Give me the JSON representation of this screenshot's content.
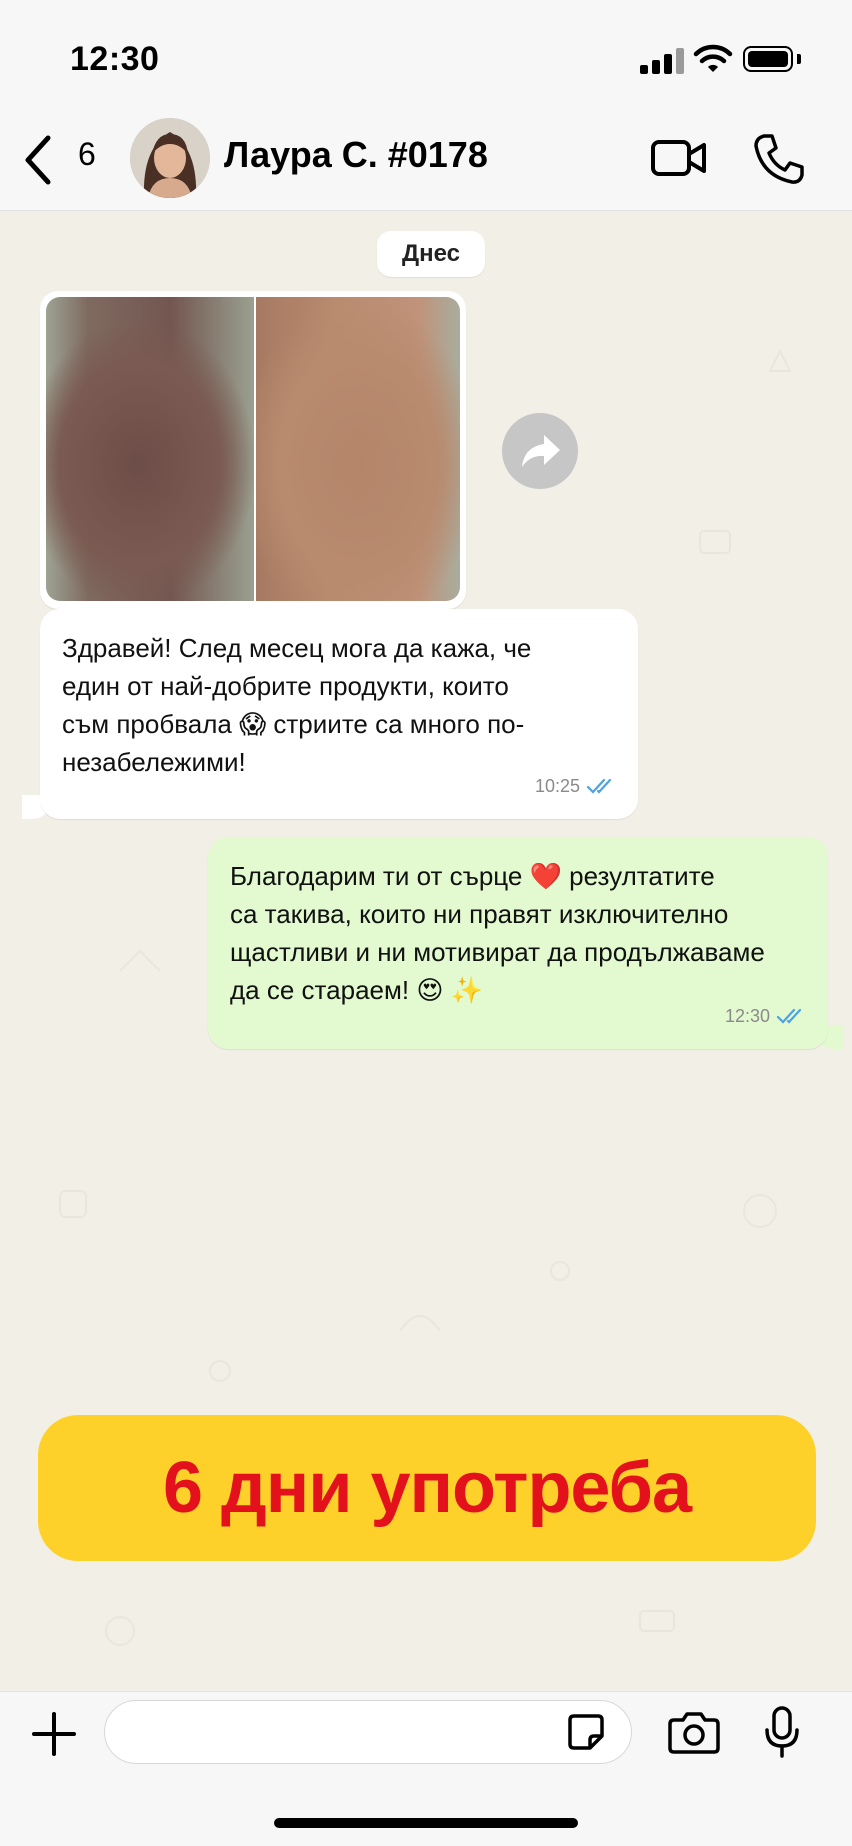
{
  "status_bar": {
    "time": "12:30"
  },
  "header": {
    "unread_count": "6",
    "contact_name": "Лаура С. #0178"
  },
  "chat": {
    "date_chip": "Днес",
    "incoming": {
      "text": "Здравей! След месец мога да кажа, че\nедин от най-добрите продукти, които\nсъм пробвала 😱 стриите са много по-\nнезабележими!",
      "time": "10:25"
    },
    "outgoing": {
      "text": "Благодарим ти от сърце ❤️ резултатите\nса такива, които ни правят изключително\nщастливи и ни мотивират да продължаваме\nда се стараем! 😍 ✨",
      "time": "12:30"
    },
    "promo_banner": "6 дни употреба"
  },
  "input": {
    "value": "",
    "placeholder": ""
  },
  "colors": {
    "chat_background": "#f2efe7",
    "outgoing_bubble": "#e3fad1",
    "incoming_bubble": "#ffffff",
    "read_ticks": "#4fa3e0",
    "promo_background": "#fed12a",
    "promo_text": "#e3111c"
  },
  "icons": [
    "back-icon",
    "video-call-icon",
    "phone-icon",
    "forward-icon",
    "read-ticks-icon",
    "plus-icon",
    "sticker-icon",
    "camera-icon",
    "microphone-icon",
    "signal-icon",
    "wifi-icon",
    "battery-icon"
  ]
}
